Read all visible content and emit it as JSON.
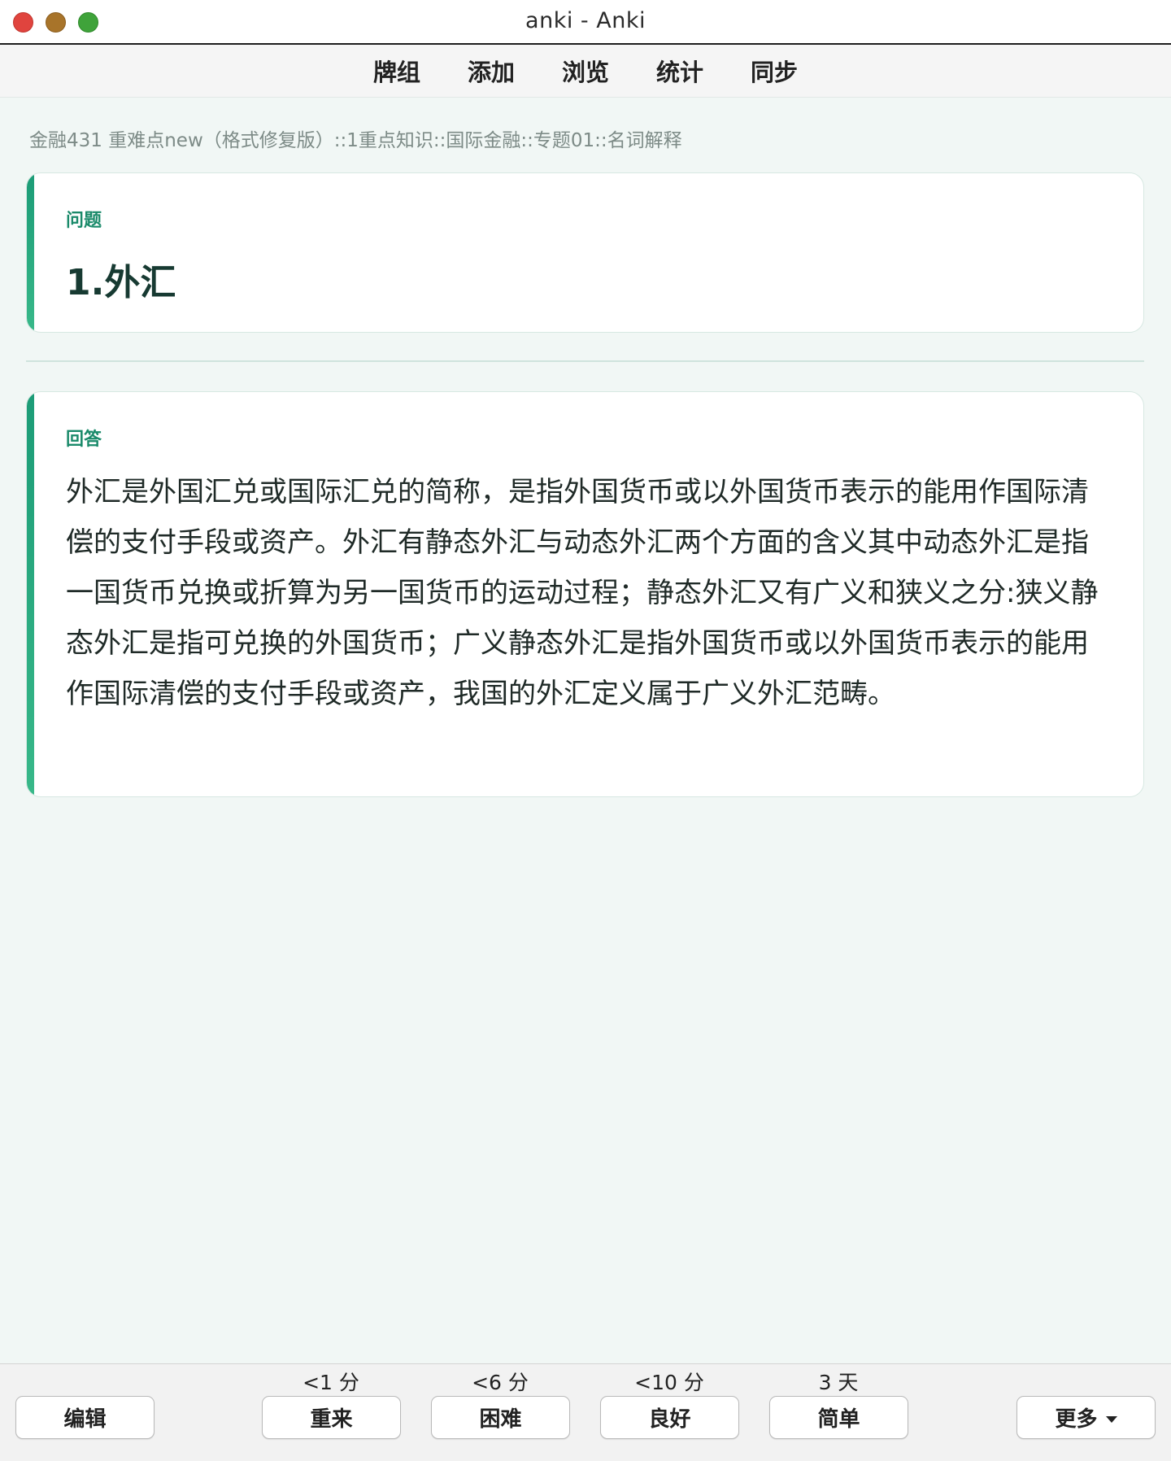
{
  "window": {
    "title": "anki - Anki"
  },
  "toolbar": {
    "items": [
      "牌组",
      "添加",
      "浏览",
      "统计",
      "同步"
    ]
  },
  "breadcrumb": "金融431 重难点new（格式修复版）::1重点知识::国际金融::专题01::名词解释",
  "question": {
    "label": "问题",
    "text": "1.外汇"
  },
  "answer": {
    "label": "回答",
    "text": "外汇是外国汇兑或国际汇兑的简称，是指外国货币或以外国货币表示的能用作国际清偿的支付手段或资产。外汇有静态外汇与动态外汇两个方面的含义其中动态外汇是指一国货币兑换或折算为另一国货币的运动过程；静态外汇又有广义和狭义之分:狭义静态外汇是指可兑换的外国货币；广义静态外汇是指外国货币或以外国货币表示的能用作国际清偿的支付手段或资产，我国的外汇定义属于广义外汇范畴。"
  },
  "bottom": {
    "edit_label": "编辑",
    "more_label": "更多",
    "answers": [
      {
        "label": "重来",
        "interval": "<1 分"
      },
      {
        "label": "困难",
        "interval": "<6 分"
      },
      {
        "label": "良好",
        "interval": "<10 分"
      },
      {
        "label": "简单",
        "interval": "3 天"
      }
    ]
  },
  "colors": {
    "accent": "#1c9c77",
    "label": "#1a8a6a",
    "background": "#f1f7f5"
  }
}
